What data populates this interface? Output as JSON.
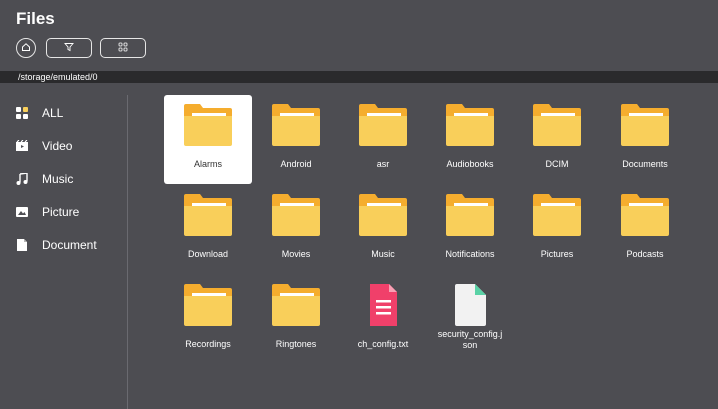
{
  "app": {
    "title": "Files"
  },
  "toolbar": {
    "home_icon": "home-icon",
    "filter_icon": "filter-icon",
    "view_icon": "grid-view-icon"
  },
  "path": "/storage/emulated/0",
  "sidebar": {
    "items": [
      {
        "label": "ALL",
        "icon": "grid-icon",
        "selected": true
      },
      {
        "label": "Video",
        "icon": "video-icon"
      },
      {
        "label": "Music",
        "icon": "music-note-icon"
      },
      {
        "label": "Picture",
        "icon": "image-icon"
      },
      {
        "label": "Document",
        "icon": "document-icon"
      }
    ]
  },
  "files": [
    {
      "name": "Alarms",
      "type": "folder",
      "selected": true
    },
    {
      "name": "Android",
      "type": "folder"
    },
    {
      "name": "asr",
      "type": "folder"
    },
    {
      "name": "Audiobooks",
      "type": "folder"
    },
    {
      "name": "DCIM",
      "type": "folder"
    },
    {
      "name": "Documents",
      "type": "folder"
    },
    {
      "name": "Download",
      "type": "folder"
    },
    {
      "name": "Movies",
      "type": "folder"
    },
    {
      "name": "Music",
      "type": "folder"
    },
    {
      "name": "Notifications",
      "type": "folder"
    },
    {
      "name": "Pictures",
      "type": "folder"
    },
    {
      "name": "Podcasts",
      "type": "folder"
    },
    {
      "name": "Recordings",
      "type": "folder"
    },
    {
      "name": "Ringtones",
      "type": "folder"
    },
    {
      "name": "ch_config.txt",
      "type": "text-file"
    },
    {
      "name": "security_config.json",
      "display": [
        "security_config.j",
        "son"
      ],
      "type": "json-file"
    }
  ],
  "colors": {
    "background": "#4d4d52",
    "path_bar": "#2a2a2c",
    "folder": "#f9cf5a",
    "folder_tab": "#f5ad2e",
    "text_file": "#f0406a",
    "json_file": "#f2f2f2",
    "json_fold": "#5ad2a6",
    "selected_tile": "#ffffff"
  }
}
